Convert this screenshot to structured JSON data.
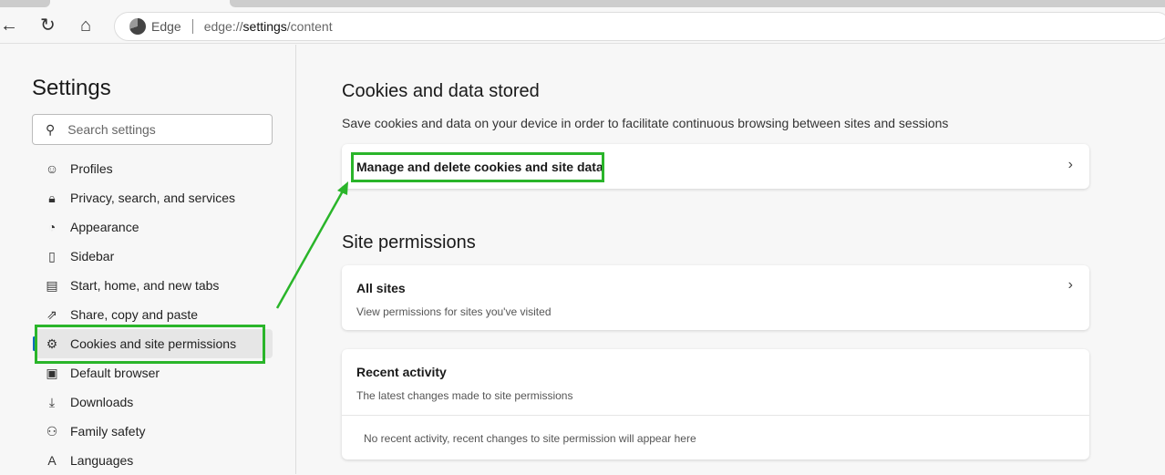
{
  "browser": {
    "back_icon": "←",
    "refresh_icon": "↻",
    "home_icon": "⌂",
    "site_label": "Edge",
    "url_prefix": "edge://",
    "url_bold": "settings",
    "url_suffix": "/content"
  },
  "sidebar": {
    "title": "Settings",
    "search_placeholder": "Search settings",
    "items": [
      {
        "label": "Profiles",
        "icon": "☺"
      },
      {
        "label": "Privacy, search, and services",
        "icon": "🔒︎"
      },
      {
        "label": "Appearance",
        "icon": "◔"
      },
      {
        "label": "Sidebar",
        "icon": "▯"
      },
      {
        "label": "Start, home, and new tabs",
        "icon": "▤"
      },
      {
        "label": "Share, copy and paste",
        "icon": "⇗"
      },
      {
        "label": "Cookies and site permissions",
        "icon": "⚙"
      },
      {
        "label": "Default browser",
        "icon": "▣"
      },
      {
        "label": "Downloads",
        "icon": "⤓"
      },
      {
        "label": "Family safety",
        "icon": "⚇"
      },
      {
        "label": "Languages",
        "icon": "A"
      }
    ]
  },
  "main": {
    "cookies": {
      "title": "Cookies and data stored",
      "description": "Save cookies and data on your device in order to facilitate continuous browsing between sites and sessions",
      "manage_label": "Manage and delete cookies and site data"
    },
    "permissions": {
      "title": "Site permissions",
      "all_sites_title": "All sites",
      "all_sites_sub": "View permissions for sites you've visited",
      "recent_title": "Recent activity",
      "recent_sub": "The latest changes made to site permissions",
      "recent_empty": "No recent activity, recent changes to site permission will appear here"
    }
  },
  "colors": {
    "highlight": "#2ab52a",
    "accent": "#0f6cbd"
  }
}
